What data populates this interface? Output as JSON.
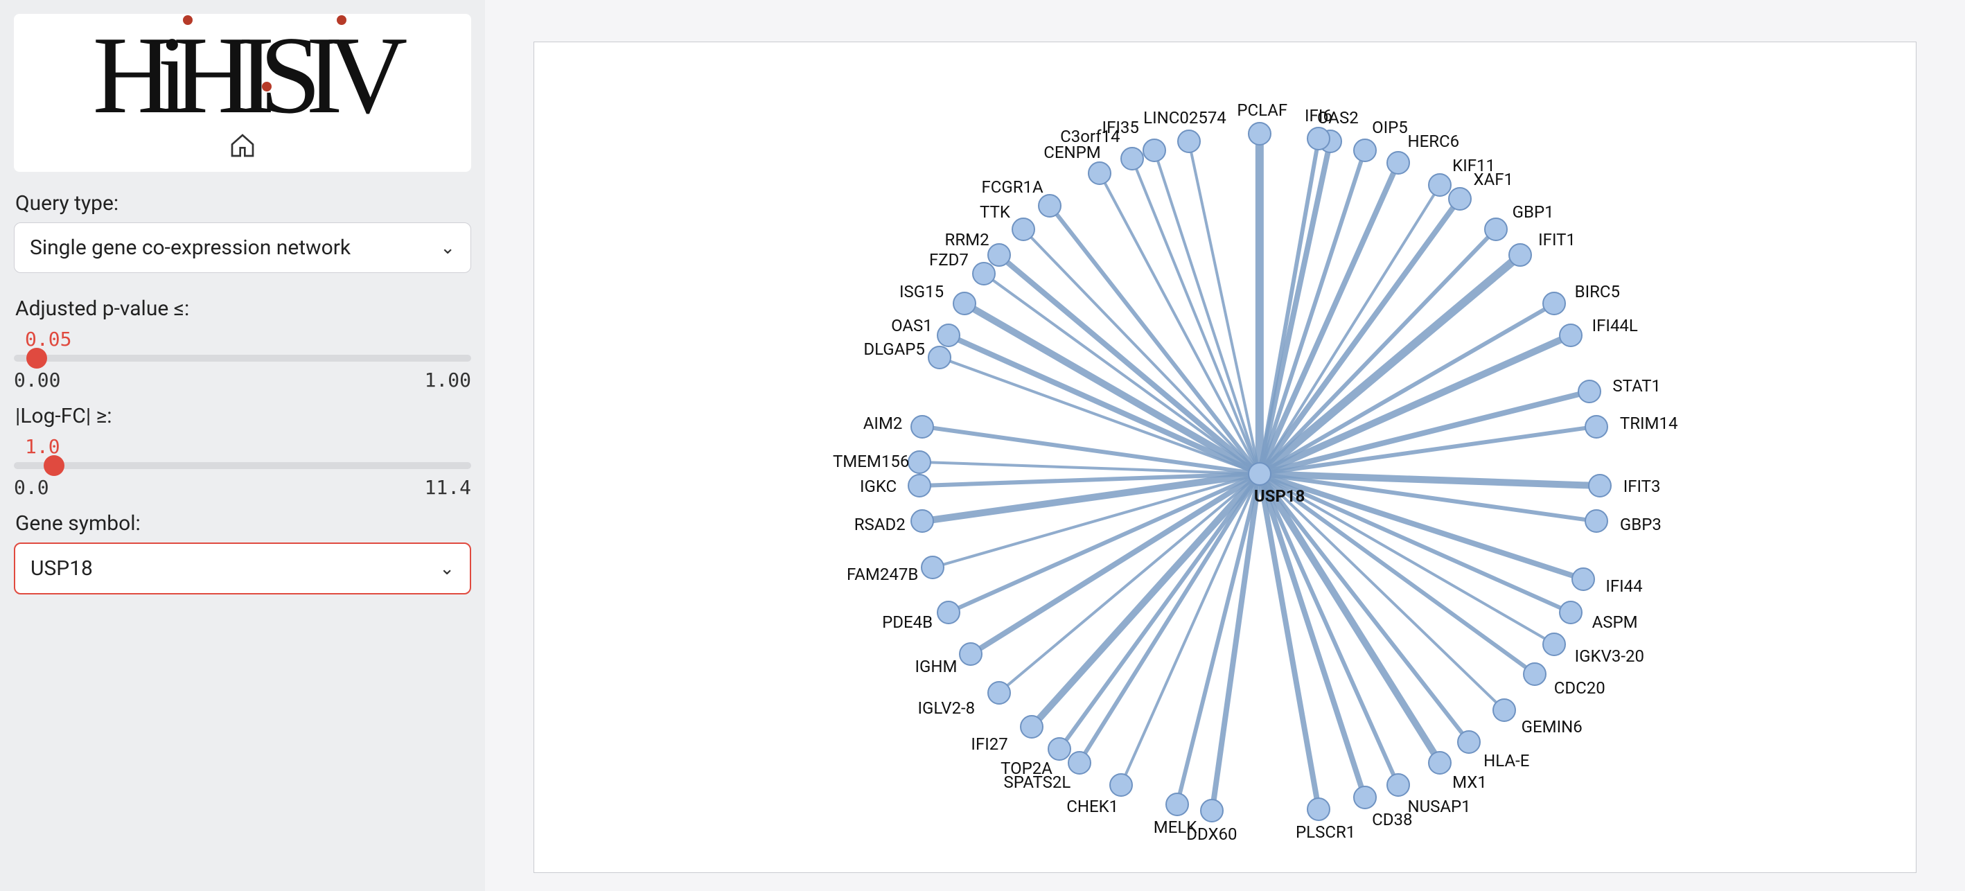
{
  "sidebar": {
    "logo_text": "HiHISIV",
    "home_icon_name": "home-icon",
    "query_type_label": "Query type:",
    "query_type_value": "Single gene co-expression network",
    "pvalue_label": "Adjusted p-value ≤:",
    "pvalue_value": "0.05",
    "pvalue_min": "0.00",
    "pvalue_max": "1.00",
    "pvalue_percent": 5,
    "logfc_label": "|Log-FC| ≥:",
    "logfc_value": "1.0",
    "logfc_min": "0.0",
    "logfc_max": "11.4",
    "logfc_percent": 8.77,
    "gene_label": "Gene symbol:",
    "gene_value": "USP18"
  },
  "graph": {
    "center": "USP18",
    "nodes": [
      {
        "label": "PCLAF",
        "angle": -90,
        "w": 6
      },
      {
        "label": "OAS2",
        "angle": -78,
        "w": 4
      },
      {
        "label": "LINC02574",
        "angle": -102,
        "w": 2
      },
      {
        "label": "IFI35",
        "angle": -108,
        "w": 2
      },
      {
        "label": "IFI6",
        "angle": -80,
        "w": 3
      },
      {
        "label": "HERC6",
        "angle": -66,
        "w": 4
      },
      {
        "label": "KIF11",
        "angle": -58,
        "w": 2
      },
      {
        "label": "CENPM",
        "angle": -118,
        "w": 2
      },
      {
        "label": "FCGR1A",
        "angle": -128,
        "w": 3
      },
      {
        "label": "C3orf14",
        "angle": -112,
        "w": 2
      },
      {
        "label": "OIP5",
        "angle": -72,
        "w": 3
      },
      {
        "label": "XAF1",
        "angle": -54,
        "w": 4
      },
      {
        "label": "GBP1",
        "angle": -46,
        "w": 3
      },
      {
        "label": "IFIT1",
        "angle": -40,
        "w": 6
      },
      {
        "label": "RRM2",
        "angle": -140,
        "w": 4
      },
      {
        "label": "TTK",
        "angle": -134,
        "w": 2
      },
      {
        "label": "ISG15",
        "angle": -150,
        "w": 5
      },
      {
        "label": "FZD7",
        "angle": -144,
        "w": 2
      },
      {
        "label": "BIRC5",
        "angle": -30,
        "w": 3
      },
      {
        "label": "IFI44L",
        "angle": -24,
        "w": 5
      },
      {
        "label": "DLGAP5",
        "angle": -160,
        "w": 2
      },
      {
        "label": "OAS1",
        "angle": -156,
        "w": 4
      },
      {
        "label": "STAT1",
        "angle": -14,
        "w": 4
      },
      {
        "label": "TRIM14",
        "angle": -8,
        "w": 3
      },
      {
        "label": "AIM2",
        "angle": -172,
        "w": 3
      },
      {
        "label": "TMEM156",
        "angle": -178,
        "w": 2
      },
      {
        "label": "IFIT3",
        "angle": 2,
        "w": 5
      },
      {
        "label": "GBP3",
        "angle": 8,
        "w": 3
      },
      {
        "label": "RSAD2",
        "angle": 172,
        "w": 5
      },
      {
        "label": "IGKC",
        "angle": 178,
        "w": 3
      },
      {
        "label": "IFI44",
        "angle": 18,
        "w": 4
      },
      {
        "label": "ASPM",
        "angle": 24,
        "w": 3
      },
      {
        "label": "FAM247B",
        "angle": 164,
        "w": 2
      },
      {
        "label": "IGKV3-20",
        "angle": 30,
        "w": 2
      },
      {
        "label": "CDC20",
        "angle": 36,
        "w": 3
      },
      {
        "label": "PDE4B",
        "angle": 156,
        "w": 3
      },
      {
        "label": "IGHM",
        "angle": 148,
        "w": 4
      },
      {
        "label": "GEMIN6",
        "angle": 44,
        "w": 2
      },
      {
        "label": "HLA-E",
        "angle": 52,
        "w": 3
      },
      {
        "label": "IGLV2-8",
        "angle": 140,
        "w": 2
      },
      {
        "label": "SPATS2L",
        "angle": 122,
        "w": 3
      },
      {
        "label": "IFI27",
        "angle": 132,
        "w": 5
      },
      {
        "label": "NUSAP1",
        "angle": 66,
        "w": 3
      },
      {
        "label": "MX1",
        "angle": 58,
        "w": 5
      },
      {
        "label": "CHEK1",
        "angle": 114,
        "w": 2
      },
      {
        "label": "DDX60",
        "angle": 98,
        "w": 4
      },
      {
        "label": "PLSCR1",
        "angle": 80,
        "w": 4
      },
      {
        "label": "CD38",
        "angle": 72,
        "w": 4
      },
      {
        "label": "TOP2A",
        "angle": 126,
        "w": 3
      },
      {
        "label": "MELK",
        "angle": 104,
        "w": 3
      }
    ]
  }
}
